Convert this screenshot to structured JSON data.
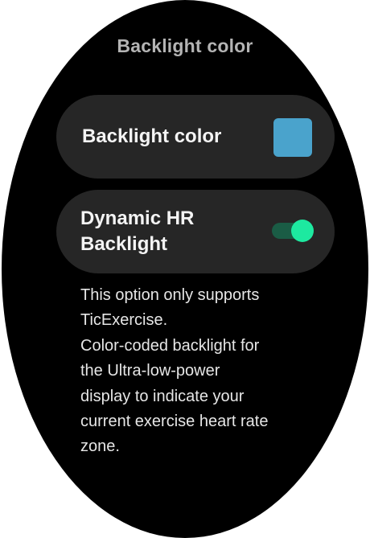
{
  "screen": {
    "title": "Backlight color"
  },
  "settings": {
    "backlight_color": {
      "label": "Backlight color",
      "swatch_color": "#4aa3cc"
    },
    "dynamic_hr_backlight": {
      "label": "Dynamic HR\nBacklight",
      "enabled": true
    }
  },
  "description": "This option only supports\nTicExercise.\nColor-coded backlight for\nthe Ultra-low-power\ndisplay to indicate your\ncurrent exercise heart rate\nzone.",
  "colors": {
    "background": "#000000",
    "card": "#262626",
    "toggle_on_knob": "#1de9a0",
    "toggle_on_track": "#1a5c45"
  }
}
